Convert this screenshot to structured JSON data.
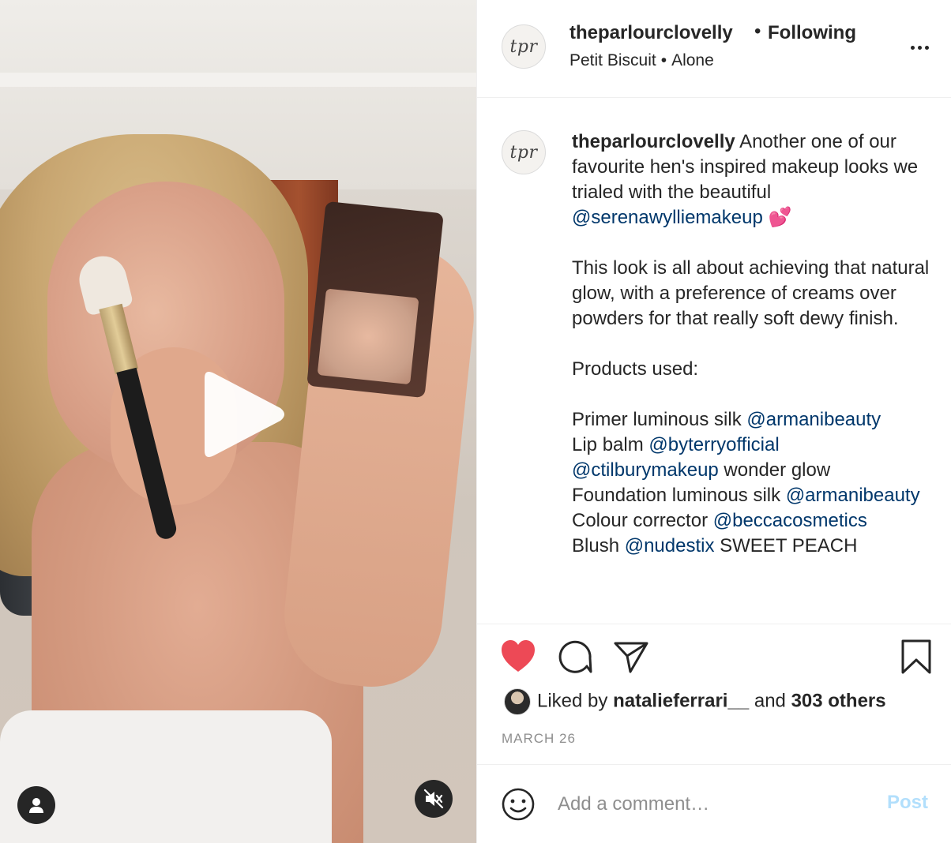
{
  "post": {
    "username": "theparlourclovelly",
    "follow_separator": "•",
    "follow_status": "Following",
    "audio_artist": "Petit Biscuit",
    "audio_separator": "•",
    "audio_track": "Alone",
    "avatar_text": "tpr"
  },
  "caption": {
    "username": "theparlourclovelly",
    "line1": " Another one of our favourite hen's inspired makeup looks we trialed with the beautiful ",
    "mention1": "@serenawylliemakeup",
    "emoji1": " 💕",
    "para2": "This look is all about achieving that natural glow, with a preference of creams over powders for that really soft dewy finish.",
    "products_heading": "Products used:",
    "products": [
      {
        "pre": "Primer luminous silk ",
        "mention": "@armanibeauty",
        "post": ""
      },
      {
        "pre": "Lip balm ",
        "mention": "@byterryofficial",
        "post": ""
      },
      {
        "pre": "",
        "mention": "@ctilburymakeup",
        "post": " wonder glow"
      },
      {
        "pre": "Foundation luminous silk ",
        "mention": "@armanibeauty",
        "post": ""
      },
      {
        "pre": "Colour corrector ",
        "mention": "@beccacosmetics",
        "post": ""
      },
      {
        "pre": "Blush ",
        "mention": "@nudestix",
        "post": " SWEET PEACH"
      }
    ]
  },
  "likes": {
    "prefix": "Liked by ",
    "user": "natalieferrari__",
    "middle": " and ",
    "others": "303 others"
  },
  "date": "MARCH 26",
  "comment": {
    "placeholder": "Add a comment…",
    "post_label": "Post"
  },
  "colors": {
    "like_red": "#ed4956",
    "mention_blue": "#00376b",
    "post_disabled": "#b2dffc"
  },
  "icons": {
    "like": "heart-icon",
    "comment": "comment-icon",
    "share": "paper-plane-icon",
    "save": "bookmark-icon",
    "play": "play-icon",
    "mute": "sound-off-icon",
    "user": "user-icon",
    "emoji": "smiley-icon"
  }
}
